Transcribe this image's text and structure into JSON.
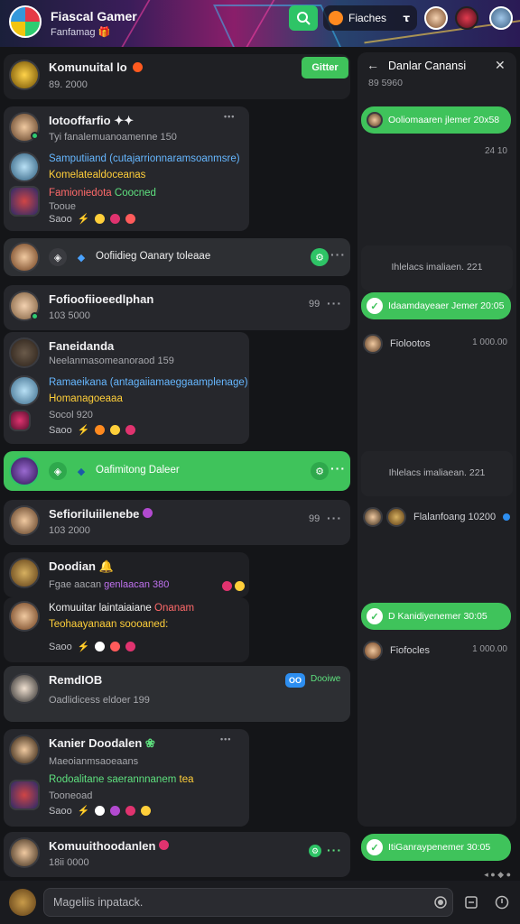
{
  "header": {
    "title": "Fiascal Gamer",
    "subtitle": "Fanfamag",
    "subtitle_badge": "🎁",
    "user_pill": "Fiaches",
    "user_pill_icon": "𝞃"
  },
  "threads": [
    {
      "name": "Komunuital lo",
      "sub": "89. 2000",
      "action": "Gitter"
    },
    {
      "name": "Iotooffarfio",
      "name_suffix": "✦✦",
      "sub": "Tyi fanalemuanoamenne 150",
      "meta": "•••",
      "lines": [
        {
          "text": "Samputiiand (cutajarrionnaramsoanmsre)",
          "color": "c-blue"
        },
        {
          "text": "Komelatealdoceanas",
          "color": "c-yellow"
        },
        {
          "text": "Famioniedota",
          "color": "c-red",
          "extra": "Coocned"
        }
      ],
      "footer": "Tooue",
      "icon_label": "Saoo"
    },
    {
      "label": "Oofiidieg Oanary toleaae",
      "type": "channel"
    },
    {
      "name": "Fofioofiioeedlphan",
      "sub": "103 5000",
      "count": "99"
    },
    {
      "name": "Faneidanda",
      "sub": "Neelanmasomeanoraod 159",
      "lines": [
        {
          "text": "Ramaeikana (antagaiiamaeggaamplenage)",
          "color": "c-blue"
        },
        {
          "text": "Homanagoeaaa",
          "color": "c-yellow"
        }
      ],
      "footer": "Socol 920",
      "icon_label": "Saoo"
    },
    {
      "label": "Oafimitong Daleer",
      "type": "channel-active"
    },
    {
      "name": "Sefioriluiilenebe",
      "sub": "103 2000",
      "count": "99"
    },
    {
      "name": "Doodian",
      "sub": "Fgae aacan",
      "sub_highlight": "genlaacan 380"
    },
    {
      "name": "Komuuitar laintaiaiane",
      "name_color": "Onanam",
      "lines": [
        {
          "text": "Teohaayanaan soooaned:",
          "color": "c-yellow"
        }
      ],
      "icon_label": "Saoo"
    },
    {
      "name": "RemdIOB",
      "sub": "Oadlidicess eldoer 199",
      "badge_a": "OO",
      "badge_b": "Dooiwe"
    },
    {
      "name": "Kanier Doodalen",
      "sub": "Maeoianmsaoeaans",
      "meta": "•••",
      "lines": [
        {
          "text": "Rodoalitane saerannnanem",
          "color": "c-green",
          "extra": "tea"
        },
        {
          "text": "Tooneoad",
          "color": "c-white"
        }
      ],
      "icon_label": "Saoo"
    },
    {
      "name": "Komuuithoodanlen",
      "sub": "18ii 0000",
      "count": ""
    }
  ],
  "panel": {
    "title": "Danlar Canansi",
    "sub": "89 5960",
    "messages": [
      {
        "text": "Ooliomaaren jlemer 20x58",
        "time": "24 10"
      },
      {
        "label": "Ihlelacs imaliaen. 221"
      },
      {
        "text": "Idaamdayeaer Jemer 20:05"
      },
      {
        "row": "Fiolootos",
        "time": "1 000.00"
      },
      {
        "label": "Ihlelacs imaliaean. 221"
      },
      {
        "row": "Flalanfoang 10200"
      },
      {
        "text": "D Kanidiyenemer 30:05"
      },
      {
        "row": "Fiofocles",
        "time": "1 000.00"
      },
      {
        "text": "ItiGanraypenemer 30:05"
      }
    ]
  },
  "composer": {
    "placeholder": "Mageliis inpatack."
  },
  "colors": {
    "accent": "#3fc35b",
    "bg": "#141518",
    "card": "#26272c"
  }
}
